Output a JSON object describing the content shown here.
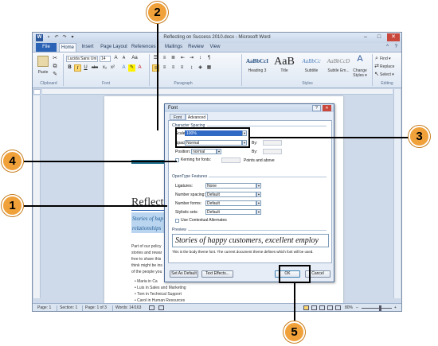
{
  "window": {
    "title": "Reflecting on Success 2010.docx - Microsoft Word",
    "app_icon": "W",
    "qat_icons": [
      "save-icon",
      "undo-icon",
      "redo-icon",
      "customize-icon"
    ],
    "qat_glyphs": [
      "▪",
      "↶",
      "↷",
      "▾"
    ],
    "controls": [
      "–",
      "□",
      "✕"
    ],
    "extra_icons": [
      "^",
      "?"
    ]
  },
  "ribbon_tabs": [
    "File",
    "Home",
    "Insert",
    "Page Layout",
    "References",
    "Mailings",
    "Review",
    "View"
  ],
  "ribbon": {
    "clipboard": {
      "label": "Clipboard",
      "paste": "Paste"
    },
    "font": {
      "label": "Font",
      "font_name": "Lucida Sans Uni",
      "font_size": "14",
      "grow": "A",
      "shrink": "A",
      "aa": "Aa",
      "bold": "B",
      "italic": "I",
      "underline": "U",
      "strike": "abc",
      "sub": "x₂",
      "sup": "x²"
    },
    "paragraph": {
      "label": "Paragraph",
      "pilcrow": "¶"
    },
    "styles": {
      "label": "Styles",
      "items": [
        {
          "sample": "AaBbCcI",
          "name": "Heading 3"
        },
        {
          "sample": "AaB",
          "name": "Title"
        },
        {
          "sample": "AaBbCc",
          "name": "Subtitle"
        },
        {
          "sample": "AaBbCcD",
          "name": "Subtle Em..."
        }
      ],
      "change_styles": "Change Styles ▾"
    },
    "editing": {
      "label": "Editing",
      "find": "Find ▾",
      "replace": "Replace",
      "select": "Select ▾"
    }
  },
  "document": {
    "title": "Reflecti",
    "subtitle_line1": "Stories of hap",
    "subtitle_line2": "relationships",
    "body_lines": [
      "Part of our policy",
      "stories and rewar",
      "free to share this",
      "think might be ins",
      "of the people you"
    ],
    "bullets": [
      "Maria in Ca",
      "Luis in Sales and Marketing",
      "Tom in Technical Support",
      "Carol in Human Resources"
    ]
  },
  "status_bar": {
    "page": "Page: 1",
    "section": "Section: 1",
    "page_of": "Page: 1 of 3",
    "words": "Words: 14/163",
    "zoom": "80%",
    "zoom_minus": "–",
    "zoom_plus": "+",
    "zoom_level": 0.6
  },
  "font_dialog": {
    "title": "Font",
    "help": "?",
    "close": "✕",
    "tabs": [
      "Font",
      "Advanced"
    ],
    "character_spacing": {
      "heading": "Character Spacing",
      "scale_label": "Scale:",
      "scale_value": "100%",
      "spacing_label": "Spacing:",
      "spacing_value": "Normal",
      "by_label": "By:",
      "position_label": "Position:",
      "position_value": "normal",
      "position_by_label": "By:",
      "kerning_label": "Kerning for fonts:",
      "kerning_suffix": "Points and above"
    },
    "opentype": {
      "heading": "OpenType Features",
      "ligatures_label": "Ligatures:",
      "ligatures_value": "None",
      "number_spacing_label": "Number spacing:",
      "number_spacing_value": "Default",
      "number_forms_label": "Number forms:",
      "number_forms_value": "Default",
      "stylistic_sets_label": "Stylistic sets:",
      "stylistic_sets_value": "Default",
      "contextual_label": "Use Contextual Alternates"
    },
    "preview": {
      "heading": "Preview",
      "text": "Stories of happy customers, excellent employ",
      "description": "This is the body theme font. The current document theme defines which font will be used."
    },
    "buttons": {
      "set_default": "Set As Default",
      "text_effects": "Text Effects...",
      "ok": "OK",
      "cancel": "Cancel"
    }
  },
  "callouts": [
    "2",
    "3",
    "4",
    "1",
    "5"
  ],
  "colors": {
    "callout": "#f0a13a",
    "file_tab": "#2a62b5",
    "selection": "#316ac5"
  }
}
